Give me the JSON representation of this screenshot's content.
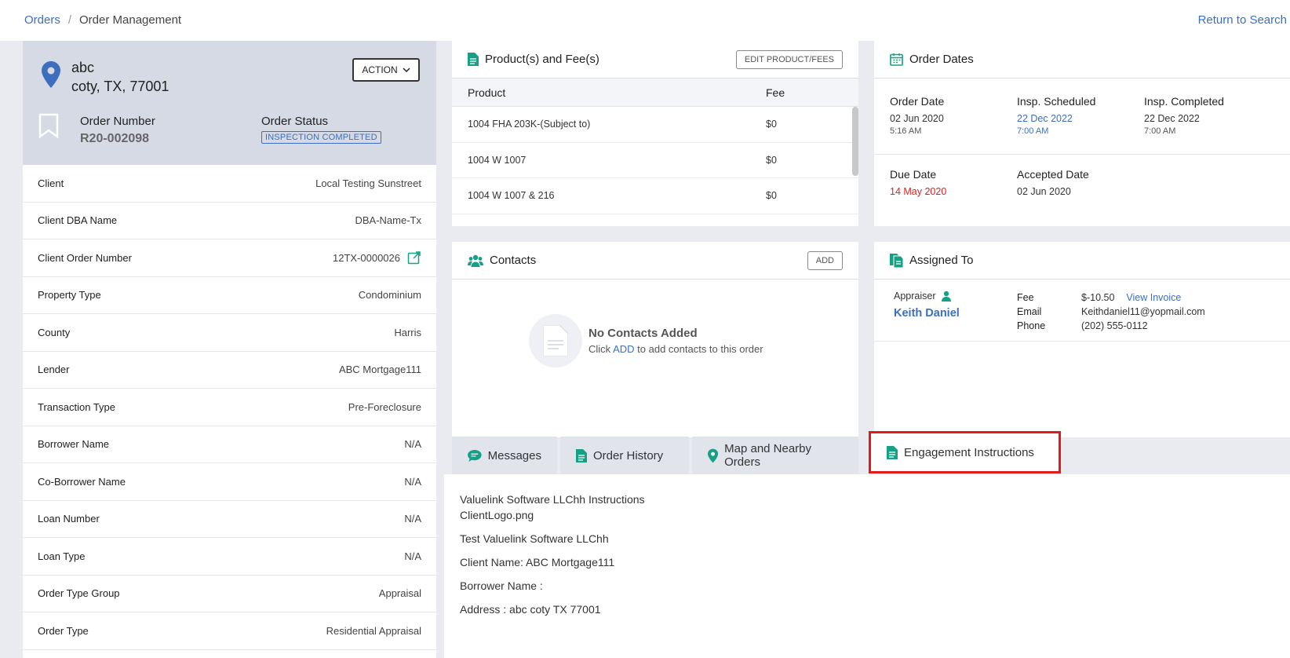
{
  "breadcrumb": {
    "root": "Orders",
    "separator": "/",
    "current": "Order Management"
  },
  "return_link": "Return to Search",
  "property": {
    "address_line1": "abc",
    "address_line2": "coty, TX, 77001",
    "action_label": "ACTION",
    "order_number_label": "Order Number",
    "order_number": "R20-002098",
    "order_status_label": "Order Status",
    "order_status": "INSPECTION COMPLETED"
  },
  "details": [
    {
      "label": "Client",
      "value": "Local Testing Sunstreet"
    },
    {
      "label": "Client DBA Name",
      "value": "DBA-Name-Tx"
    },
    {
      "label": "Client Order Number",
      "value": "12TX-0000026"
    },
    {
      "label": "Property Type",
      "value": "Condominium"
    },
    {
      "label": "County",
      "value": "Harris"
    },
    {
      "label": "Lender",
      "value": "ABC Mortgage111"
    },
    {
      "label": "Transaction Type",
      "value": "Pre-Foreclosure"
    },
    {
      "label": "Borrower Name",
      "value": "N/A"
    },
    {
      "label": "Co-Borrower Name",
      "value": "N/A"
    },
    {
      "label": "Loan Number",
      "value": "N/A"
    },
    {
      "label": "Loan Type",
      "value": "N/A"
    },
    {
      "label": "Order Type Group",
      "value": "Appraisal"
    },
    {
      "label": "Order Type",
      "value": "Residential Appraisal"
    }
  ],
  "products": {
    "title": "Product(s) and Fee(s)",
    "edit_label": "EDIT PRODUCT/FEES",
    "col_product": "Product",
    "col_fee": "Fee",
    "rows": [
      {
        "product": "1004 FHA 203K-(Subject to)",
        "fee": "$0"
      },
      {
        "product": "1004 W 1007",
        "fee": "$0"
      },
      {
        "product": "1004 W 1007 & 216",
        "fee": "$0"
      }
    ]
  },
  "order_dates": {
    "title": "Order Dates",
    "order_date_label": "Order Date",
    "order_date": "02 Jun 2020",
    "order_time": "5:16 AM",
    "insp_sched_label": "Insp. Scheduled",
    "insp_sched_date": "22 Dec 2022",
    "insp_sched_time": "7:00 AM",
    "insp_comp_label": "Insp. Completed",
    "insp_comp_date": "22 Dec 2022",
    "insp_comp_time": "7:00 AM",
    "due_label": "Due Date",
    "due_date": "14 May 2020",
    "accepted_label": "Accepted Date",
    "accepted_date": "02 Jun 2020"
  },
  "contacts": {
    "title": "Contacts",
    "add_label": "ADD",
    "empty_title": "No Contacts Added",
    "empty_pre": "Click",
    "empty_link": "ADD",
    "empty_post": "to add contacts to this order"
  },
  "assigned": {
    "title": "Assigned To",
    "role": "Appraiser",
    "name": "Keith Daniel",
    "fee_label": "Fee",
    "fee": "$-10.50",
    "invoice_link": "View Invoice",
    "email_label": "Email",
    "email": "Keithdaniel11@yopmail.com",
    "phone_label": "Phone",
    "phone": "(202) 555-0112"
  },
  "tabs": [
    {
      "label": "Messages"
    },
    {
      "label": "Order History"
    },
    {
      "label": "Map and Nearby Orders"
    },
    {
      "label": "Engagement Instructions"
    }
  ],
  "instructions": {
    "line1": "Valuelink Software LLChh Instructions",
    "line2": "ClientLogo.png",
    "line3": "Test Valuelink Software LLChh",
    "line4": "Client Name: ABC Mortgage111",
    "line5": "Borrower Name :",
    "line6": "Address : abc coty TX 77001"
  },
  "colors": {
    "accent": "#3e6fbf",
    "teal": "#16a085",
    "alert": "#e02020",
    "highlight": "#e31a1a"
  }
}
